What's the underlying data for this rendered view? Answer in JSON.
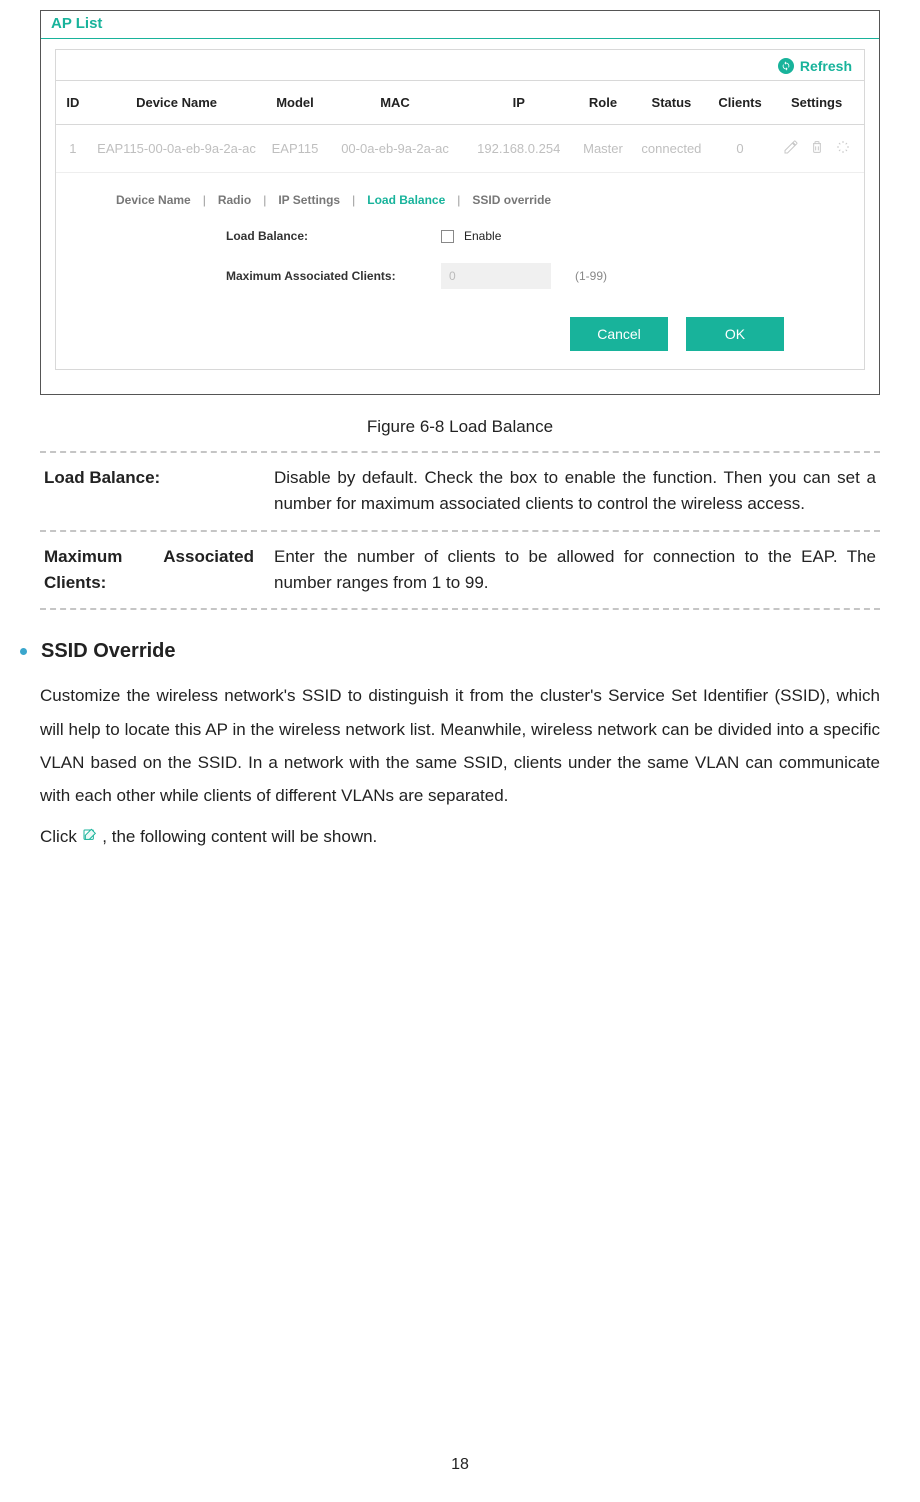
{
  "screenshot": {
    "title": "AP List",
    "refresh_label": "Refresh",
    "columns": [
      "ID",
      "Device Name",
      "Model",
      "MAC",
      "IP",
      "Role",
      "Status",
      "Clients",
      "Settings"
    ],
    "row": {
      "id": "1",
      "device_name": "EAP115-00-0a-eb-9a-2a-ac",
      "model": "EAP115",
      "mac": "00-0a-eb-9a-2a-ac",
      "ip": "192.168.0.254",
      "role": "Master",
      "status": "connected",
      "clients": "0"
    },
    "tabs": [
      "Device Name",
      "Radio",
      "IP Settings",
      "Load Balance",
      "SSID override"
    ],
    "active_tab_index": 3,
    "form": {
      "load_balance_label": "Load Balance:",
      "enable_label": "Enable",
      "max_clients_label": "Maximum Associated Clients:",
      "max_clients_value": "0",
      "max_clients_hint": "(1-99)",
      "cancel_label": "Cancel",
      "ok_label": "OK"
    }
  },
  "figure_caption": "Figure 6-8 Load Balance",
  "definitions": [
    {
      "term": "Load Balance:",
      "desc": "Disable by default. Check the box to enable the function. Then you can set a number for maximum associated clients to control the wireless access."
    },
    {
      "term": "Maximum Associated Clients:",
      "desc": "Enter the number of clients to be allowed for connection to the EAP. The number ranges from 1 to 99."
    }
  ],
  "ssid_section": {
    "title": "SSID Override",
    "para1": "Customize the wireless network's SSID to distinguish it from the cluster's Service Set Identifier (SSID), which will help to locate this AP in the wireless network list. Meanwhile, wireless network can be divided into a specific VLAN based on the SSID. In a network with the same SSID, clients under the same VLAN can communicate with each other while clients of different VLANs are separated.",
    "para2_pre": "Click ",
    "para2_post": " , the following content will be shown."
  },
  "page_number": "18"
}
